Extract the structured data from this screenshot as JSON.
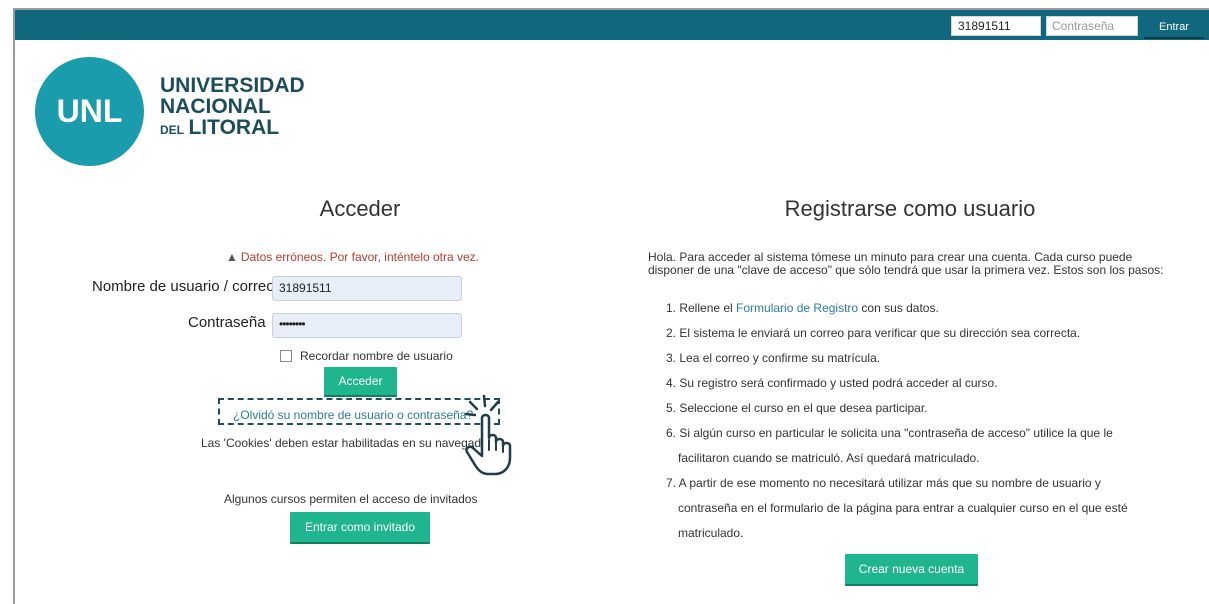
{
  "topbar": {
    "username_value": "31891511",
    "password_placeholder": "Contraseña",
    "login_button": "Entrar"
  },
  "logo": {
    "initials": "UNL",
    "line1": "UNIVERSIDAD",
    "line2": "NACIONAL",
    "line3_small": "DEL",
    "line3_big": "LITORAL"
  },
  "login": {
    "title": "Acceder",
    "error": "Datos erróneos. Por favor, inténtelo otra vez.",
    "username_label": "Nombre de usuario / correo",
    "username_value": "31891511",
    "password_label": "Contraseña",
    "password_value": "••••••••",
    "remember_label": "Recordar nombre de usuario",
    "submit": "Acceder",
    "forgot_link": "¿Olvidó su nombre de usuario o contraseña?",
    "cookies_notice": "Las 'Cookies' deben estar habilitadas en su navegador",
    "guest_text": "Algunos cursos permiten el acceso de invitados",
    "guest_button": "Entrar como invitado"
  },
  "register": {
    "title": "Registrarse como usuario",
    "intro": "Hola. Para acceder al sistema tómese un minuto para crear una cuenta. Cada curso puede disponer de una \"clave de acceso\" que sólo tendrá que usar la primera vez. Estos son los pasos:",
    "step1_prefix": "1. Rellene el ",
    "step1_link": "Formulario de Registro",
    "step1_suffix": " con sus datos.",
    "step2": "2. El sistema le enviará un correo para verificar que su dirección sea correcta.",
    "step3": "3. Lea el correo y confirme su matrícula.",
    "step4": "4. Su registro será confirmado y usted podrá acceder al curso.",
    "step5": "5. Seleccione el curso en el que desea participar.",
    "step6a": "6. Si algún curso en particular le solicita una \"contraseña de acceso\" utilice la que le",
    "step6b": "facilitaron cuando se matriculó. Así quedará matriculado.",
    "step7a": "7. A partir de ese momento no necesitará utilizar más que su nombre de usuario y",
    "step7b": "contraseña en el formulario de la página para entrar a cualquier curso en el que esté",
    "step7c": "matriculado.",
    "create_button": "Crear nueva cuenta"
  },
  "colors": {
    "topbar": "#10677e",
    "accent_button": "#1fb58f",
    "logo_circle": "#1a9cad",
    "error": "#c0392b",
    "link": "#2a7ca0"
  }
}
